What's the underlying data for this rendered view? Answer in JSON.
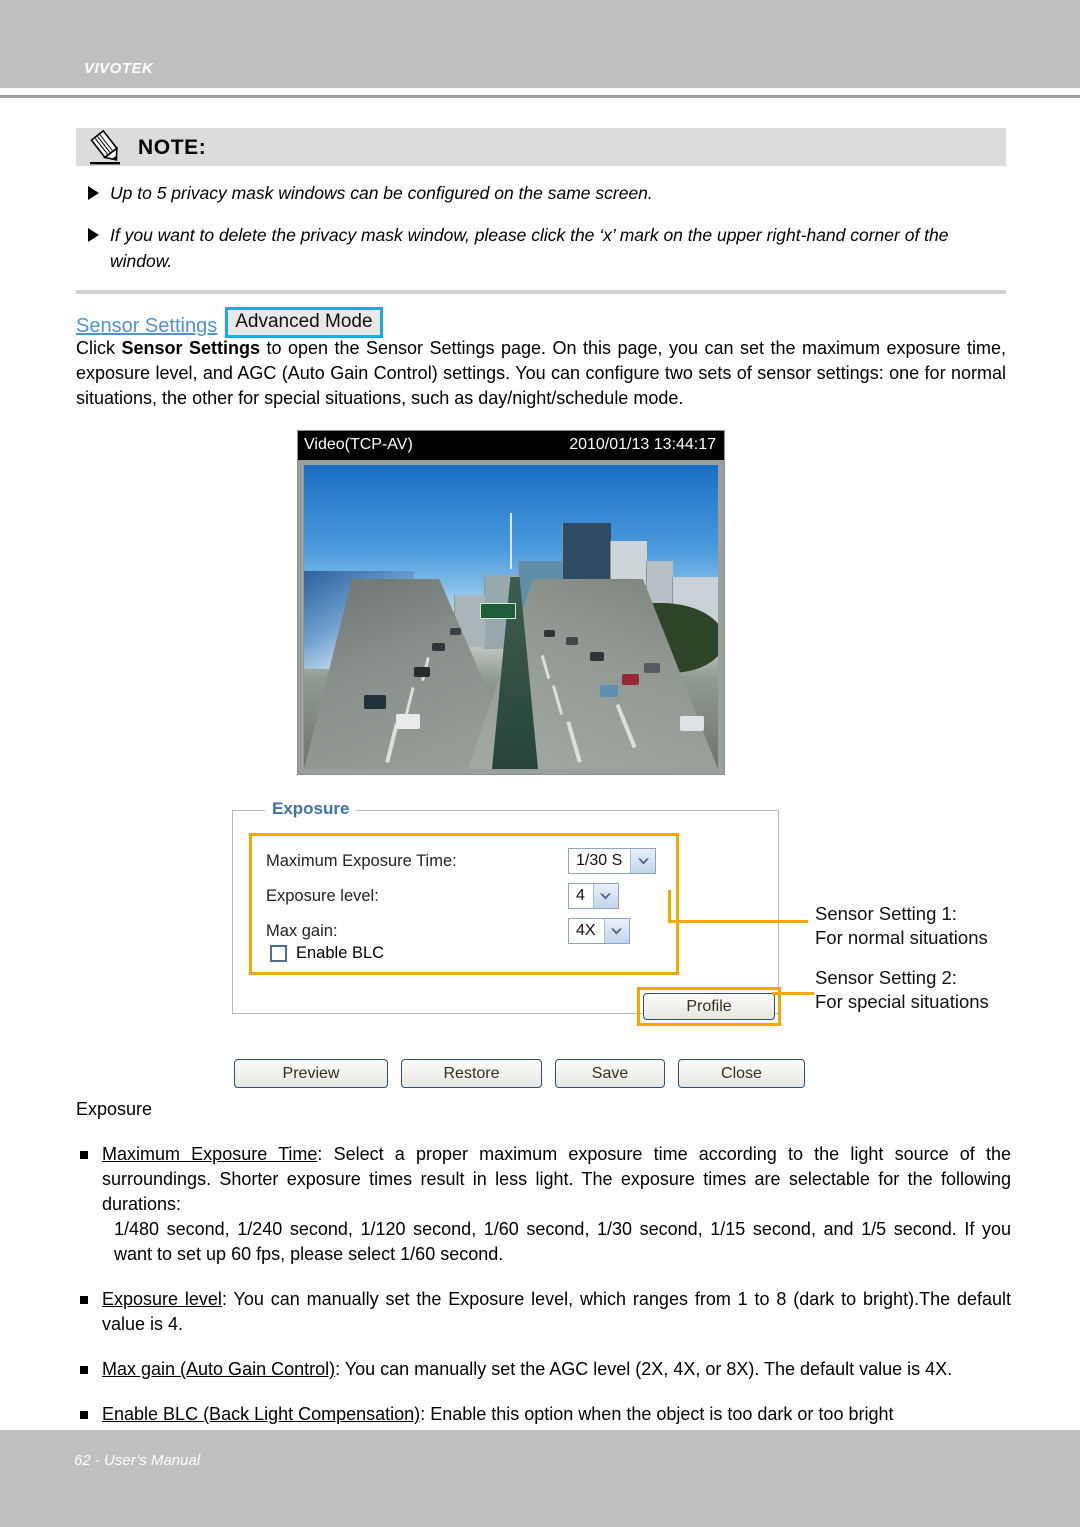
{
  "header": {
    "brand": "VIVOTEK"
  },
  "note": {
    "title": "NOTE:",
    "icon": "pencil-icon",
    "items": [
      "Up to 5 privacy mask windows can be configured on the same screen.",
      "If you want to delete the privacy mask window, please click the ‘x’ mark on the upper right-hand corner of the window."
    ]
  },
  "section": {
    "link_label": "Sensor Settings",
    "badge_label": "Advanced Mode",
    "paragraph_prefix": "Click ",
    "paragraph_bold": "Sensor Settings",
    "paragraph_rest": " to open the Sensor Settings page. On this page, you can set the maximum exposure time, exposure level, and AGC (Auto Gain Control) settings. You can configure two sets of sensor settings: one for normal situations, the other for special situations, such as day/night/schedule mode."
  },
  "video": {
    "title": "Video(TCP-AV)",
    "timestamp": "2010/01/13 13:44:17"
  },
  "panel": {
    "legend": "Exposure",
    "fields": [
      {
        "label": "Maximum Exposure Time:",
        "value": "1/30 S"
      },
      {
        "label": "Exposure level:",
        "value": "4"
      },
      {
        "label": "Max gain:",
        "value": "4X"
      }
    ],
    "checkbox": {
      "label": "Enable BLC",
      "checked": false
    },
    "profile_button": "Profile"
  },
  "annotations": {
    "setting1_line1": "Sensor Setting 1:",
    "setting1_line2": "For normal situations",
    "setting2_line1": "Sensor Setting 2:",
    "setting2_line2": "For special situations"
  },
  "buttons": {
    "preview": "Preview",
    "restore": "Restore",
    "save": "Save",
    "close": "Close"
  },
  "lower": {
    "heading": "Exposure",
    "bullets": [
      {
        "term": "Maximum Exposure Time",
        "text": ": Select a proper maximum exposure time according to the light source of the surroundings. Shorter exposure times result in less light. The exposure times are selectable for the following durations:",
        "extra": "1/480 second, 1/240 second, 1/120 second, 1/60 second, 1/30 second, 1/15 second, and 1/5 second. If you want to set up 60 fps, please select 1/60 second."
      },
      {
        "term": "Exposure level",
        "text": ": You can manually set the Exposure level, which ranges from 1 to 8 (dark to bright).The default value is 4.",
        "extra": ""
      },
      {
        "term": "Max gain (Auto Gain Control)",
        "text": ": You can manually set the AGC level (2X, 4X, or 8X). The default value is 4X.",
        "extra": ""
      },
      {
        "term": "Enable BLC (Back Light Compensation)",
        "text": ": Enable this option when the object is too dark or too bright",
        "extra": ""
      }
    ]
  },
  "footer": {
    "text": "62 - User’s Manual"
  },
  "colors": {
    "brand_band": "#c0c0c0",
    "note_band": "#dcdcdc",
    "link_blue": "#4f93d6",
    "badge_border": "#12b0e8",
    "legend_blue": "#3f72ad",
    "highlight_orange": "#f5a800"
  }
}
